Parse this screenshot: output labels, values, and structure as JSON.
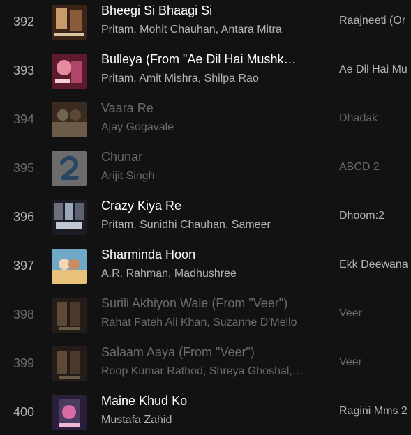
{
  "tracks": [
    {
      "index": "392",
      "title": "Bheegi Si Bhaagi Si",
      "artists": "Pritam, Mohit Chauhan, Antara Mitra",
      "album": "Raajneeti (Or",
      "dimmed": false,
      "cover_icon": "album-art-raajneeti-icon",
      "cover_colors": [
        "#3a2418",
        "#c99a6b"
      ]
    },
    {
      "index": "393",
      "title": "Bulleya (From \"Ae Dil Hai Mushk…",
      "artists": "Pritam, Amit Mishra, Shilpa Rao",
      "album": "Ae Dil Hai Mu",
      "dimmed": false,
      "cover_icon": "album-art-ae-dil-hai-mushkil-icon",
      "cover_colors": [
        "#5e1b2b",
        "#e58aa0"
      ]
    },
    {
      "index": "394",
      "title": "Vaara Re",
      "artists": "Ajay Gogavale",
      "album": "Dhadak",
      "dimmed": true,
      "cover_icon": "album-art-dhadak-icon",
      "cover_colors": [
        "#6b4a34",
        "#d8b48a"
      ]
    },
    {
      "index": "395",
      "title": "Chunar",
      "artists": "Arijit Singh",
      "album": "ABCD 2",
      "dimmed": true,
      "cover_icon": "album-art-abcd-2-icon",
      "cover_colors": [
        "#d9d9d9",
        "#3f86c9"
      ]
    },
    {
      "index": "396",
      "title": "Crazy Kiya Re",
      "artists": "Pritam, Sunidhi Chauhan, Sameer",
      "album": "Dhoom:2",
      "dimmed": false,
      "cover_icon": "album-art-dhoom-2-icon",
      "cover_colors": [
        "#1c1c24",
        "#9aa7b8"
      ]
    },
    {
      "index": "397",
      "title": "Sharminda Hoon",
      "artists": "A.R. Rahman, Madhushree",
      "album": "Ekk Deewana",
      "dimmed": false,
      "cover_icon": "album-art-ekk-deewana-tha-icon",
      "cover_colors": [
        "#6fa9c7",
        "#e8c27a"
      ]
    },
    {
      "index": "398",
      "title": "Surili Akhiyon Wale (From \"Veer\")",
      "artists": "Rahat Fateh Ali Khan, Suzanne D'Mello",
      "album": "Veer",
      "dimmed": true,
      "cover_icon": "album-art-veer-icon",
      "cover_colors": [
        "#3b2a22",
        "#b78d63"
      ]
    },
    {
      "index": "399",
      "title": "Salaam Aaya (From \"Veer\")",
      "artists": "Roop Kumar Rathod, Shreya Ghoshal,…",
      "album": "Veer",
      "dimmed": true,
      "cover_icon": "album-art-veer-icon",
      "cover_colors": [
        "#3b2a22",
        "#b78d63"
      ]
    },
    {
      "index": "400",
      "title": "Maine Khud Ko",
      "artists": "Mustafa Zahid",
      "album": "Ragini Mms 2",
      "dimmed": false,
      "cover_icon": "album-art-ragini-mms-2-icon",
      "cover_colors": [
        "#2a1f3a",
        "#d86aa6"
      ]
    }
  ]
}
